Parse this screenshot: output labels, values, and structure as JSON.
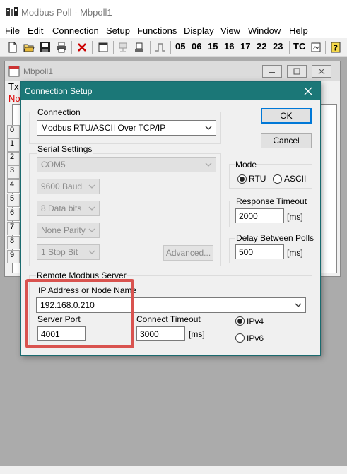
{
  "app": {
    "title": "Modbus Poll - Mbpoll1",
    "menu": [
      "File",
      "Edit",
      "Connection",
      "Setup",
      "Functions",
      "Display",
      "View",
      "Window",
      "Help"
    ],
    "function_codes": [
      "05",
      "06",
      "15",
      "16",
      "17",
      "22",
      "23"
    ],
    "tc_label": "TC"
  },
  "mdi": {
    "title": "Mbpoll1",
    "row_prefix_line1": "Tx",
    "row_prefix_line2": "No",
    "rows": [
      "0",
      "1",
      "2",
      "3",
      "4",
      "5",
      "6",
      "7",
      "8",
      "9"
    ]
  },
  "dialog": {
    "title": "Connection Setup",
    "connection_label": "Connection",
    "connection_value": "Modbus RTU/ASCII Over TCP/IP",
    "ok_label": "OK",
    "cancel_label": "Cancel",
    "serial_settings_label": "Serial Settings",
    "port": "COM5",
    "baud": "9600 Baud",
    "data_bits": "8 Data bits",
    "parity": "None Parity",
    "stop_bits": "1 Stop Bit",
    "advanced_label": "Advanced...",
    "mode_label": "Mode",
    "rtu_label": "RTU",
    "ascii_label": "ASCII",
    "mode_selected": "RTU",
    "response_timeout_label": "Response Timeout",
    "response_timeout_value": "2000",
    "response_timeout_unit": "[ms]",
    "delay_label": "Delay Between Polls",
    "delay_value": "500",
    "delay_unit": "[ms]",
    "remote_label": "Remote Modbus Server",
    "ip_label": "IP Address or Node Name",
    "ip_value": "192.168.0.210",
    "server_port_label": "Server Port",
    "server_port_value": "4001",
    "connect_timeout_label": "Connect Timeout",
    "connect_timeout_value": "3000",
    "connect_timeout_unit": "[ms]",
    "ipv4_label": "IPv4",
    "ipv6_label": "IPv6",
    "ip_version_selected": "IPv4"
  },
  "colors": {
    "dialog_title_bg": "#1b7777",
    "highlight": "#d9534f"
  }
}
